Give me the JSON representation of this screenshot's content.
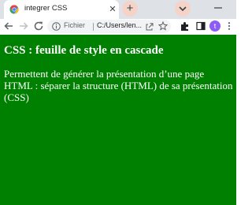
{
  "browser": {
    "tab": {
      "title": "integrer CSS",
      "close_glyph": "✕",
      "favicon": "chrome-page-icon"
    },
    "new_tab_glyph": "+",
    "security_label": "Fichier",
    "address": "C:/Users/len...",
    "avatar_letter": "t",
    "colors": {
      "tabstrip": "#dee1e6",
      "accent_button": "#f6d3c8",
      "avatar": "#8b5cf6"
    }
  },
  "page": {
    "heading": "CSS : feuille de style en cascade",
    "paragraph": "Permettent de générer la présentation d’une page HTML : séparer la structure (HTML) de sa présentation (CSS)",
    "background": "#008000",
    "text_color": "#ffffff"
  }
}
